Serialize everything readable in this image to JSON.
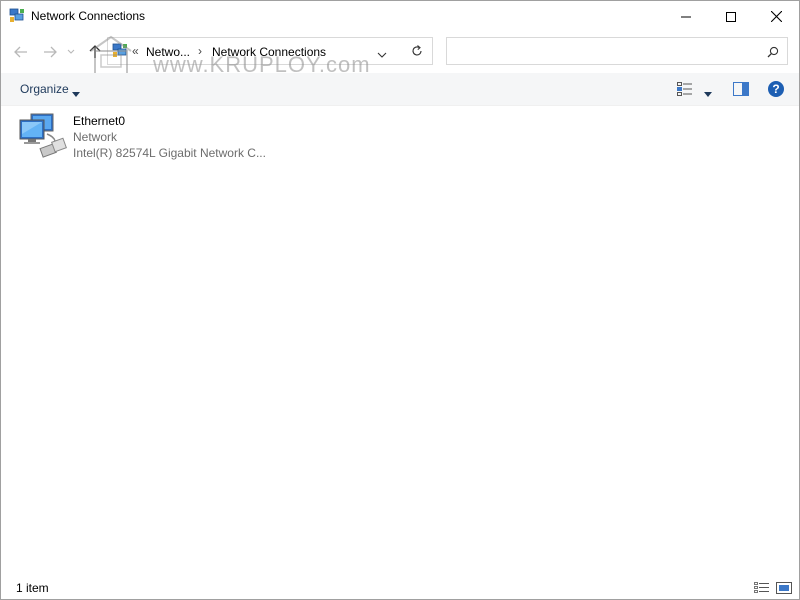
{
  "window": {
    "title": "Network Connections",
    "app_icon": "network-connections-icon",
    "controls": [
      "minimize-icon",
      "maximize-icon",
      "close-icon"
    ]
  },
  "nav": {
    "back_icon": "back-arrow-icon",
    "forward_icon": "forward-arrow-icon",
    "recent_icon": "recent-locations-chevron-icon",
    "up_icon": "up-arrow-icon",
    "breadcrumb": {
      "overflow": "«",
      "items": [
        "Netwo...",
        "Network Connections"
      ],
      "separator": "›"
    },
    "refresh_icon": "refresh-icon",
    "search": {
      "placeholder": "",
      "icon": "search-icon"
    }
  },
  "watermark": {
    "text": "www.KRUPLOY.com"
  },
  "commandbar": {
    "organize_label": "Organize",
    "view_icon": "change-view-icon",
    "preview_pane_icon": "preview-pane-icon",
    "help_label": "?"
  },
  "items": [
    {
      "name": "Ethernet0",
      "network": "Network",
      "adapter": "Intel(R) 82574L Gigabit Network C...",
      "icon": "ethernet-adapter-icon"
    }
  ],
  "status": {
    "count_text": "1 item",
    "details_view_icon": "details-view-icon",
    "large_icons_view_icon": "large-icons-view-icon"
  },
  "colors": {
    "accent": "#1d5fb3",
    "organize_text": "#1e395b",
    "secondary_text": "#6d6d6d",
    "commandbar_bg": "#f5f6f7"
  }
}
